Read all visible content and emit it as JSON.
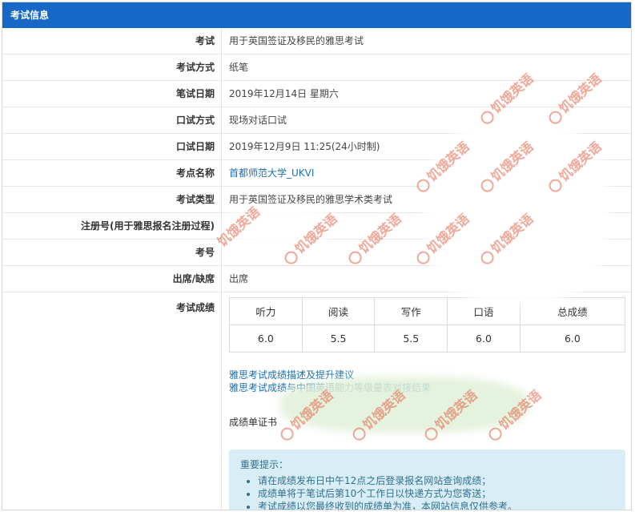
{
  "panel": {
    "title": "考试信息"
  },
  "rows": [
    {
      "label": "考试",
      "value": "用于英国签证及移民的雅思考试"
    },
    {
      "label": "考试方式",
      "value": "纸笔"
    },
    {
      "label": "笔试日期",
      "value": "2019年12月14日  星期六"
    },
    {
      "label": "口试方式",
      "value": "现场对话口试"
    },
    {
      "label": "口试日期",
      "value": "2019年12月9日  11:25(24小时制)"
    },
    {
      "label": "考点名称",
      "value": "首都师范大学_UKVI"
    },
    {
      "label": "考试类型",
      "value": "用于英国签证及移民的雅思学术类考试"
    },
    {
      "label": "注册号(用于雅思报名注册过程)",
      "value": ""
    },
    {
      "label": "考号",
      "value": ""
    },
    {
      "label": "出席/缺席",
      "value": "出席"
    }
  ],
  "scores": {
    "label": "考试成绩",
    "headers": [
      "听力",
      "阅读",
      "写作",
      "口语",
      "总成绩"
    ],
    "values": [
      "6.0",
      "5.5",
      "5.5",
      "6.0",
      "6.0"
    ]
  },
  "links": [
    "雅思考试成绩描述及提升建议",
    "雅思考试成绩与中国英语能力等级量表对接结果"
  ],
  "certificate_label": "成绩单证书",
  "notice": {
    "title": "重要提示：",
    "items": [
      "请在成绩发布日中午12点之后登录报名网站查询成绩；",
      "成绩单将于笔试后第10个工作日以快递方式为您寄送；",
      "考试成绩以您最终收到的成绩单为准，本网站信息仅供参考。"
    ]
  },
  "watermark": {
    "text": "饥饿英语"
  },
  "colors": {
    "header": "#1767c6",
    "link": "#1a6fb4",
    "notice_bg": "#d9edf7",
    "watermark": "#e65f41"
  }
}
